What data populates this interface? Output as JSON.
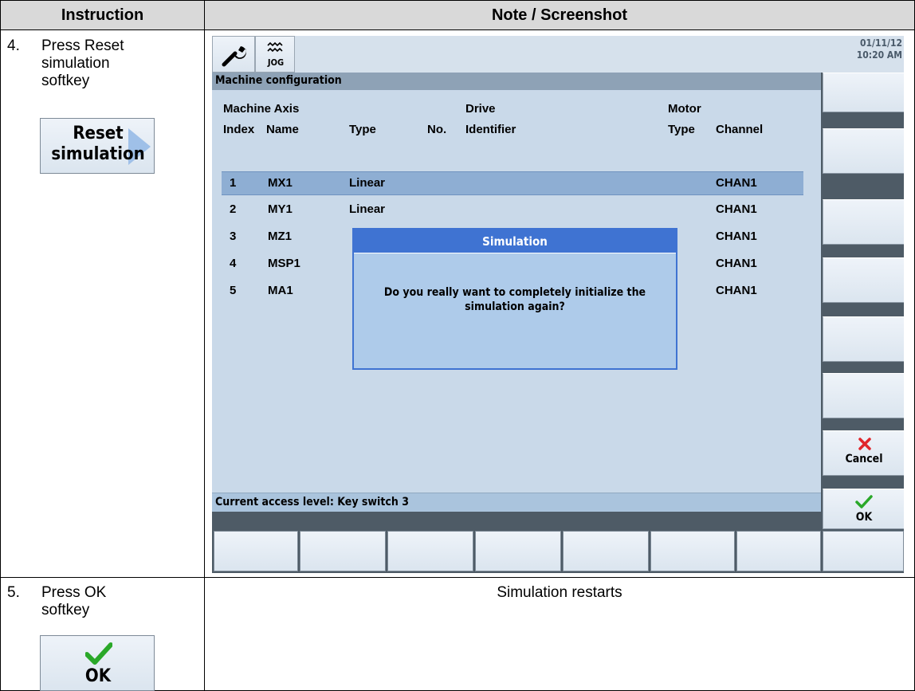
{
  "table": {
    "col1_header": "Instruction",
    "col2_header": "Note / Screenshot"
  },
  "step4": {
    "number": "4.",
    "text_lines": [
      "Press Reset",
      "simulation",
      "softkey"
    ],
    "button_lines": [
      "Reset",
      "simulation"
    ]
  },
  "step5": {
    "number": "5.",
    "text_lines": [
      "Press OK",
      "softkey"
    ],
    "button_label": "OK",
    "note": "Simulation restarts"
  },
  "hmi": {
    "mode_label": "JOG",
    "date": "01/11/12",
    "time": "10:20 AM",
    "title": "Machine configuration",
    "columns": {
      "group_machine_axis": "Machine Axis",
      "group_drive": "Drive",
      "group_motor": "Motor",
      "index": "Index",
      "name": "Name",
      "type": "Type",
      "no": "No.",
      "identifier": "Identifier",
      "motor_type": "Type",
      "channel": "Channel"
    },
    "rows": [
      {
        "index": "1",
        "name": "MX1",
        "type": "Linear",
        "channel": "CHAN1"
      },
      {
        "index": "2",
        "name": "MY1",
        "type": "Linear",
        "channel": "CHAN1"
      },
      {
        "index": "3",
        "name": "MZ1",
        "type": "",
        "channel": "CHAN1"
      },
      {
        "index": "4",
        "name": "MSP1",
        "type": "",
        "channel": "CHAN1"
      },
      {
        "index": "5",
        "name": "MA1",
        "type": "",
        "channel": "CHAN1"
      }
    ],
    "dialog": {
      "title": "Simulation",
      "message_line1": "Do you really want to completely initialize the",
      "message_line2": "simulation again?"
    },
    "status": "Current access level: Key switch 3",
    "cancel_label": "Cancel",
    "ok_label": "OK",
    "colors": {
      "selected_row": "#8eaed3",
      "dialog_title": "#3f73d2",
      "dialog_bg": "#aecbea",
      "cancel_icon": "#e0262b",
      "ok_icon": "#2aa829"
    }
  }
}
